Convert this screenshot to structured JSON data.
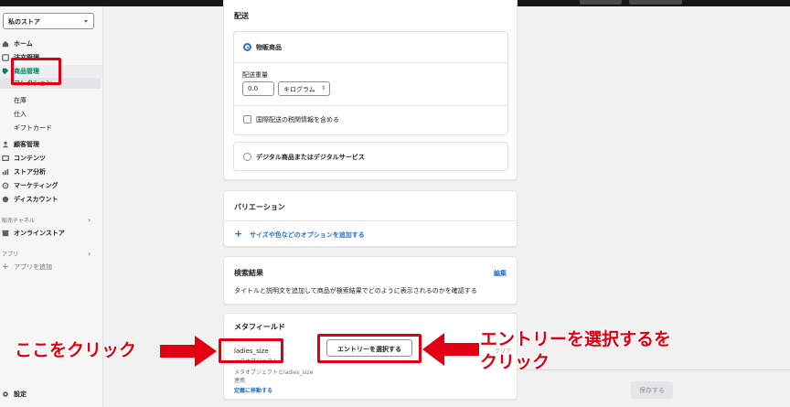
{
  "sidebar": {
    "store_name": "私のストア",
    "items": [
      {
        "label": "ホーム",
        "icon": "home-icon"
      },
      {
        "label": "注文管理",
        "icon": "orders-icon"
      },
      {
        "label": "商品管理",
        "icon": "tag-icon"
      }
    ],
    "product_sub": [
      "コレクション",
      "在庫",
      "仕入",
      "ギフトカード"
    ],
    "items2": [
      {
        "label": "顧客管理",
        "icon": "person-icon"
      },
      {
        "label": "コンテンツ",
        "icon": "content-icon"
      },
      {
        "label": "ストア分析",
        "icon": "bar-chart-icon"
      },
      {
        "label": "マーケティング",
        "icon": "target-icon"
      },
      {
        "label": "ディスカウント",
        "icon": "discount-icon"
      }
    ],
    "sales_channel_label": "販売チャネル",
    "online_store": "オンラインストア",
    "apps_label": "アプリ",
    "add_app": "アプリを追加",
    "settings": "設定"
  },
  "shipping": {
    "title": "配送",
    "physical_label": "物販商品",
    "weight_label": "配送重量",
    "weight_value": "0.0",
    "unit_value": "キログラム",
    "customs_label": "国際配送の税関情報を含める",
    "digital_label": "デジタル商品またはデジタルサービス"
  },
  "variations": {
    "title": "バリエーション",
    "add_label": "サイズや色などのオプションを追加する"
  },
  "seo": {
    "title": "検索結果",
    "edit_label": "編集",
    "description": "タイトルと説明文を追加して商品が検索結果でどのように表示されるのかを確認する"
  },
  "metafields": {
    "title": "メタフィールド",
    "key": "ladies_size",
    "key_sub": "メタオブジェクト",
    "entry_button": "エントリーを選択する",
    "clear_label": "クリア",
    "desc_line1": "メタオブジェクトとladies_size",
    "desc_line2": "連携",
    "go_to_definition": "定義に移動する"
  },
  "save_button": "保存する",
  "annotations": {
    "click_here": "ここをクリック",
    "select_entry_line1": "エントリーを選択するを",
    "select_entry_line2": "クリック"
  },
  "colors": {
    "annotation_red": "#e10012",
    "link_blue": "#2c6ecb",
    "active_green": "#008060"
  }
}
